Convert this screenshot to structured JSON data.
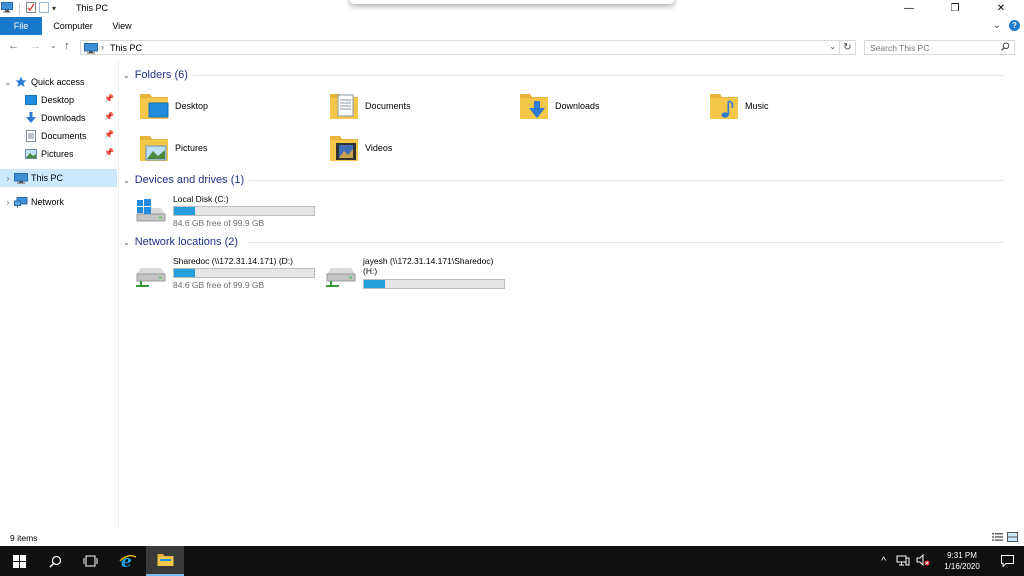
{
  "window": {
    "title": "This PC",
    "minimize": "—",
    "restore": "❐",
    "close": "✕"
  },
  "ribbon": {
    "tabs": [
      "File",
      "Computer",
      "View"
    ],
    "expand": "⌄",
    "help": "?"
  },
  "address": {
    "back": "←",
    "forward": "→",
    "recent": "⌄",
    "up": "↑",
    "chevron": "›",
    "crumb": "This PC",
    "dropdown": "⌄",
    "refresh": "↻",
    "search_placeholder": "Search This PC"
  },
  "nav": {
    "quick_access": "Quick access",
    "quick_items": [
      "Desktop",
      "Downloads",
      "Documents",
      "Pictures"
    ],
    "this_pc": "This PC",
    "network": "Network"
  },
  "groups": {
    "folders": "Folders (6)",
    "drives": "Devices and drives (1)",
    "network": "Network locations (2)"
  },
  "folders": [
    "Desktop",
    "Documents",
    "Downloads",
    "Music",
    "Pictures",
    "Videos"
  ],
  "drives": [
    {
      "name": "Local Disk (C:)",
      "free": "84.6 GB free of 99.9 GB",
      "used_fraction": 0.153
    }
  ],
  "network_locations": [
    {
      "name": "Sharedoc (\\\\172.31.14.171) (D:)",
      "free": "84.6 GB free of 99.9 GB",
      "used_fraction": 0.153
    },
    {
      "name": "jayesh (\\\\172.31.14.171\\Sharedoc)",
      "name2": "(H:)",
      "free": "",
      "used_fraction": 0.153
    }
  ],
  "status": {
    "count": "9 items"
  },
  "taskbar": {
    "time": "9:31 PM",
    "date": "1/16/2020"
  },
  "colors": {
    "accent": "#1979ca",
    "selection": "#cce8ff",
    "bar_fill": "#26a0da",
    "group_header": "#1e3287",
    "folder_yellow": "#f3c74a"
  }
}
